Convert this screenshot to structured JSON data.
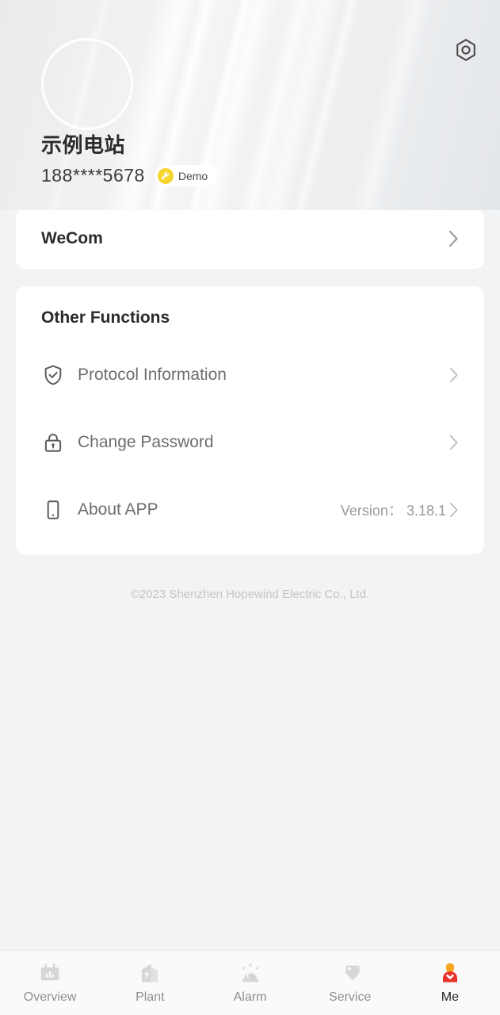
{
  "header": {
    "settings_icon": "hex-nut-settings-icon",
    "avatar_icon": "avatar-placeholder",
    "station_name": "示例电站",
    "phone": "188****5678",
    "badge": {
      "icon": "wrench-icon",
      "label": "Demo",
      "bg_color": "#f7d531"
    }
  },
  "wecom_card": {
    "label": "WeCom",
    "chevron": "chevron-right-icon"
  },
  "other_functions": {
    "title": "Other Functions",
    "items": [
      {
        "label": "Protocol Information",
        "icon": "shield-check-icon",
        "value": ""
      },
      {
        "label": "Change Password",
        "icon": "lock-icon",
        "value": ""
      },
      {
        "label": "About APP",
        "icon": "mobile-phone-icon",
        "value": "Version： 3.18.1"
      }
    ]
  },
  "copyright": "©2023 Shenzhen Hopewind Electric Co., Ltd.",
  "tabbar": {
    "active_index": 4,
    "active_color": "#e8332a",
    "items": [
      {
        "label": "Overview",
        "icon": "chart-monitor-icon"
      },
      {
        "label": "Plant",
        "icon": "power-plant-icon"
      },
      {
        "label": "Alarm",
        "icon": "alarm-siren-icon"
      },
      {
        "label": "Service",
        "icon": "tags-icon"
      },
      {
        "label": "Me",
        "icon": "person-icon"
      }
    ]
  }
}
